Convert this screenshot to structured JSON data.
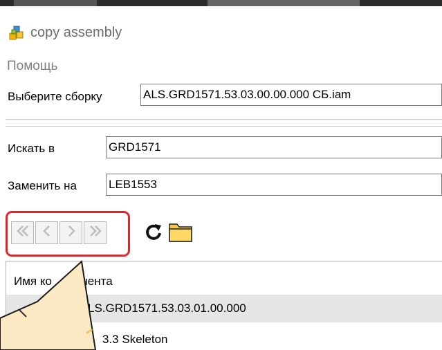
{
  "window": {
    "title": "copy assembly",
    "icon": "assembly-icon"
  },
  "menu": {
    "items": [
      {
        "label": "Помощь"
      }
    ]
  },
  "form": {
    "assembly_label": "Выберите сборку",
    "assembly_value": "ALS.GRD1571.53.03.00.00.000 СБ.iam",
    "search_label": "Искать в",
    "search_value": "GRD1571",
    "replace_label": "Заменить на",
    "replace_value": "LEB1553"
  },
  "toolbar": {
    "nav_buttons": [
      {
        "icon": "first-icon",
        "glyph": "≪"
      },
      {
        "icon": "prev-icon",
        "glyph": "<"
      },
      {
        "icon": "next-icon",
        "glyph": ">"
      },
      {
        "icon": "last-icon",
        "glyph": "≫"
      }
    ],
    "refresh_icon": "refresh-icon",
    "folder_icon": "folder-icon"
  },
  "tree": {
    "column_header_visible": "Имя ко",
    "column_header_rest": "онента",
    "rows": [
      {
        "label": "LS.GRD1571.53.03.01.00.000",
        "expanded": true,
        "selected": true
      },
      {
        "label": "3.3 Skeleton",
        "expanded": false,
        "selected": false
      }
    ]
  },
  "colors": {
    "highlight_border": "#e0262a",
    "callout_fill": "#fbe9c4",
    "selected_row": "#e6e6e6"
  }
}
